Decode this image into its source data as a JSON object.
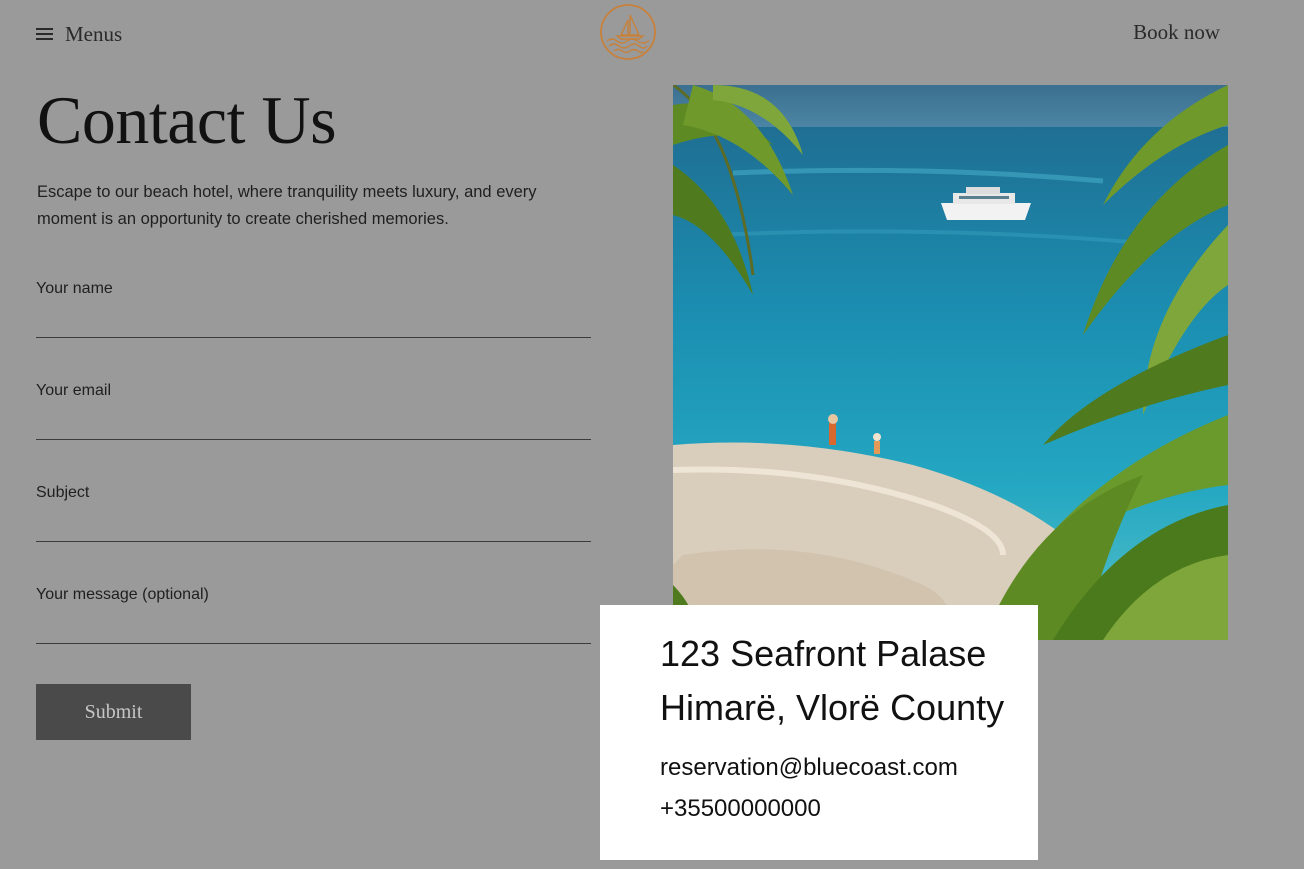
{
  "header": {
    "menu_label": "Menus",
    "book_now_label": "Book now"
  },
  "page": {
    "title": "Contact Us",
    "intro": "Escape to our beach hotel, where tranquility meets luxury, and every moment is an opportunity to create cherished memories."
  },
  "form": {
    "fields": [
      {
        "label": "Your name",
        "value": "",
        "placeholder": ""
      },
      {
        "label": "Your email",
        "value": "",
        "placeholder": ""
      },
      {
        "label": "Subject",
        "value": "",
        "placeholder": ""
      },
      {
        "label": "Your message (optional)",
        "value": "",
        "placeholder": ""
      }
    ],
    "submit_label": "Submit"
  },
  "contact": {
    "address_line1": "123 Seafront Palase",
    "address_line2": "Himarë, Vlorë County",
    "email": "reservation@bluecoast.com",
    "phone": "+35500000000"
  },
  "colors": {
    "overlay_background": "#9a9a9a",
    "logo_accent": "#c8813a",
    "submit_background": "#4a4a4a",
    "card_background": "#ffffff"
  },
  "icons": {
    "menu": "hamburger-icon",
    "logo": "sailboat-waves-logo"
  }
}
